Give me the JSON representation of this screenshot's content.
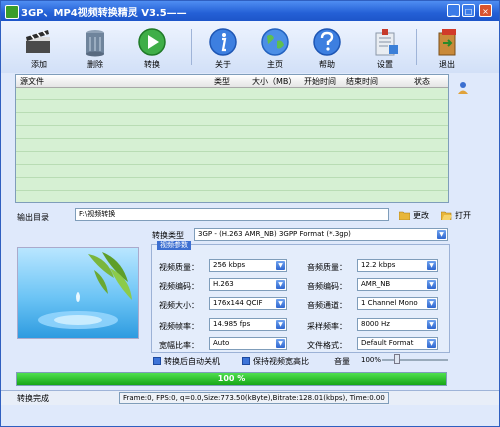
{
  "window": {
    "title": "3GP、MP4视频转换精灵 V3.5——",
    "controls": [
      "_",
      "□",
      "×"
    ]
  },
  "toolbar": {
    "items": [
      {
        "label": "添加",
        "icon": "film-clapper-icon"
      },
      {
        "label": "删除",
        "icon": "trash-can-icon"
      },
      {
        "label": "转换",
        "icon": "play-circle-icon"
      },
      {
        "label": "关于",
        "icon": "info-icon"
      },
      {
        "label": "主页",
        "icon": "globe-icon"
      },
      {
        "label": "帮助",
        "icon": "help-icon"
      },
      {
        "label": "设置",
        "icon": "settings-icon"
      },
      {
        "label": "退出",
        "icon": "exit-door-icon"
      }
    ]
  },
  "file_list": {
    "columns": [
      "源文件",
      "类型",
      "大小（MB）",
      "开始时间",
      "结束时间",
      "状态"
    ]
  },
  "output": {
    "label": "输出目录",
    "path": "F:\\视频转换",
    "change_label": "更改",
    "open_label": "打开"
  },
  "convert_type": {
    "label": "转换类型",
    "value": "3GP - (H.263 AMR_NB) 3GPP Format (*.3gp)"
  },
  "params_tab": "视频参数",
  "video": {
    "quality_label": "视频质量：",
    "quality": "256 kbps",
    "codec_label": "视频编码：",
    "codec": "H.263",
    "size_label": "视频大小：",
    "size": "176x144 QCIF",
    "fps_label": "视频帧率：",
    "fps": "14.985 fps",
    "aspect_label": "宽幅比率：",
    "aspect": "Auto"
  },
  "audio": {
    "quality_label": "音频质量：",
    "quality": "12.2  kbps",
    "codec_label": "音频编码：",
    "codec": "AMR_NB",
    "channel_label": "音频通道：",
    "channel": "1 Channel Mono",
    "rate_label": "采样频率：",
    "rate": "8000  Hz",
    "format_label": "文件格式：",
    "format": "Default Format"
  },
  "options": {
    "shutdown_label": "转换后自动关机",
    "keep_ratio_label": "保持视频宽高比",
    "volume_label": "音量",
    "volume_value": "100%",
    "volume_level": 0.2
  },
  "progress": {
    "value": 1.0,
    "label": "100 %"
  },
  "status": {
    "left": "转换完成",
    "right": "Frame:0, FPS:0, q=0.0,Size:773.50(kByte),Bitrate:128.01(kbps), Time:0.00"
  },
  "colors": {
    "accent": "#2460d6",
    "list_bg": "#d6f0d3",
    "progress": "#1fb41f"
  }
}
